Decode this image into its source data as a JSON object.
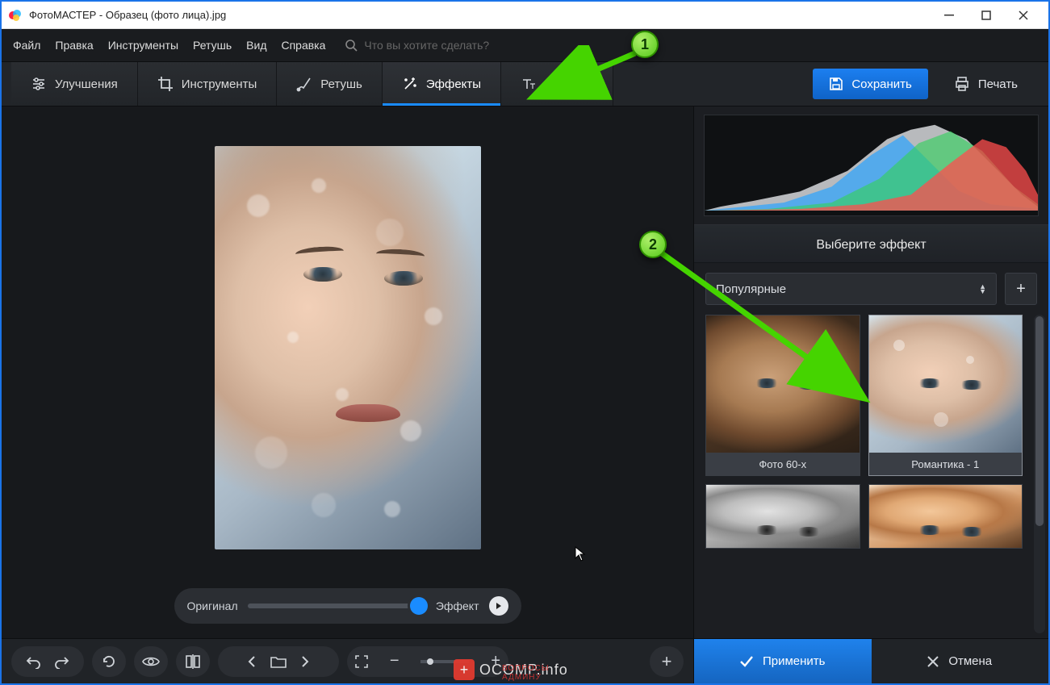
{
  "window": {
    "title": "ФотоМАСТЕР - Образец (фото лица).jpg"
  },
  "menu": {
    "file": "Файл",
    "edit": "Правка",
    "tools": "Инструменты",
    "retouch": "Ретушь",
    "view": "Вид",
    "help": "Справка",
    "search_placeholder": "Что вы хотите сделать?"
  },
  "tabs": {
    "enhance": "Улучшения",
    "tools": "Инструменты",
    "retouch": "Ретушь",
    "effects": "Эффекты",
    "text": "Надписи"
  },
  "actions": {
    "save": "Сохранить",
    "print": "Печать"
  },
  "compare": {
    "original": "Оригинал",
    "effect": "Эффект"
  },
  "side": {
    "panel_title": "Выберите эффект",
    "category": "Популярные",
    "effects": [
      {
        "id": "photo-60s",
        "label": "Фото 60-х"
      },
      {
        "id": "romantic-1",
        "label": "Романтика - 1"
      }
    ],
    "apply": "Применить",
    "cancel": "Отмена"
  },
  "annotations": {
    "badge1": "1",
    "badge2": "2"
  },
  "watermark": {
    "main": "OCOMP.info",
    "sub": "ВОПРОСЫ АДМИНУ"
  }
}
